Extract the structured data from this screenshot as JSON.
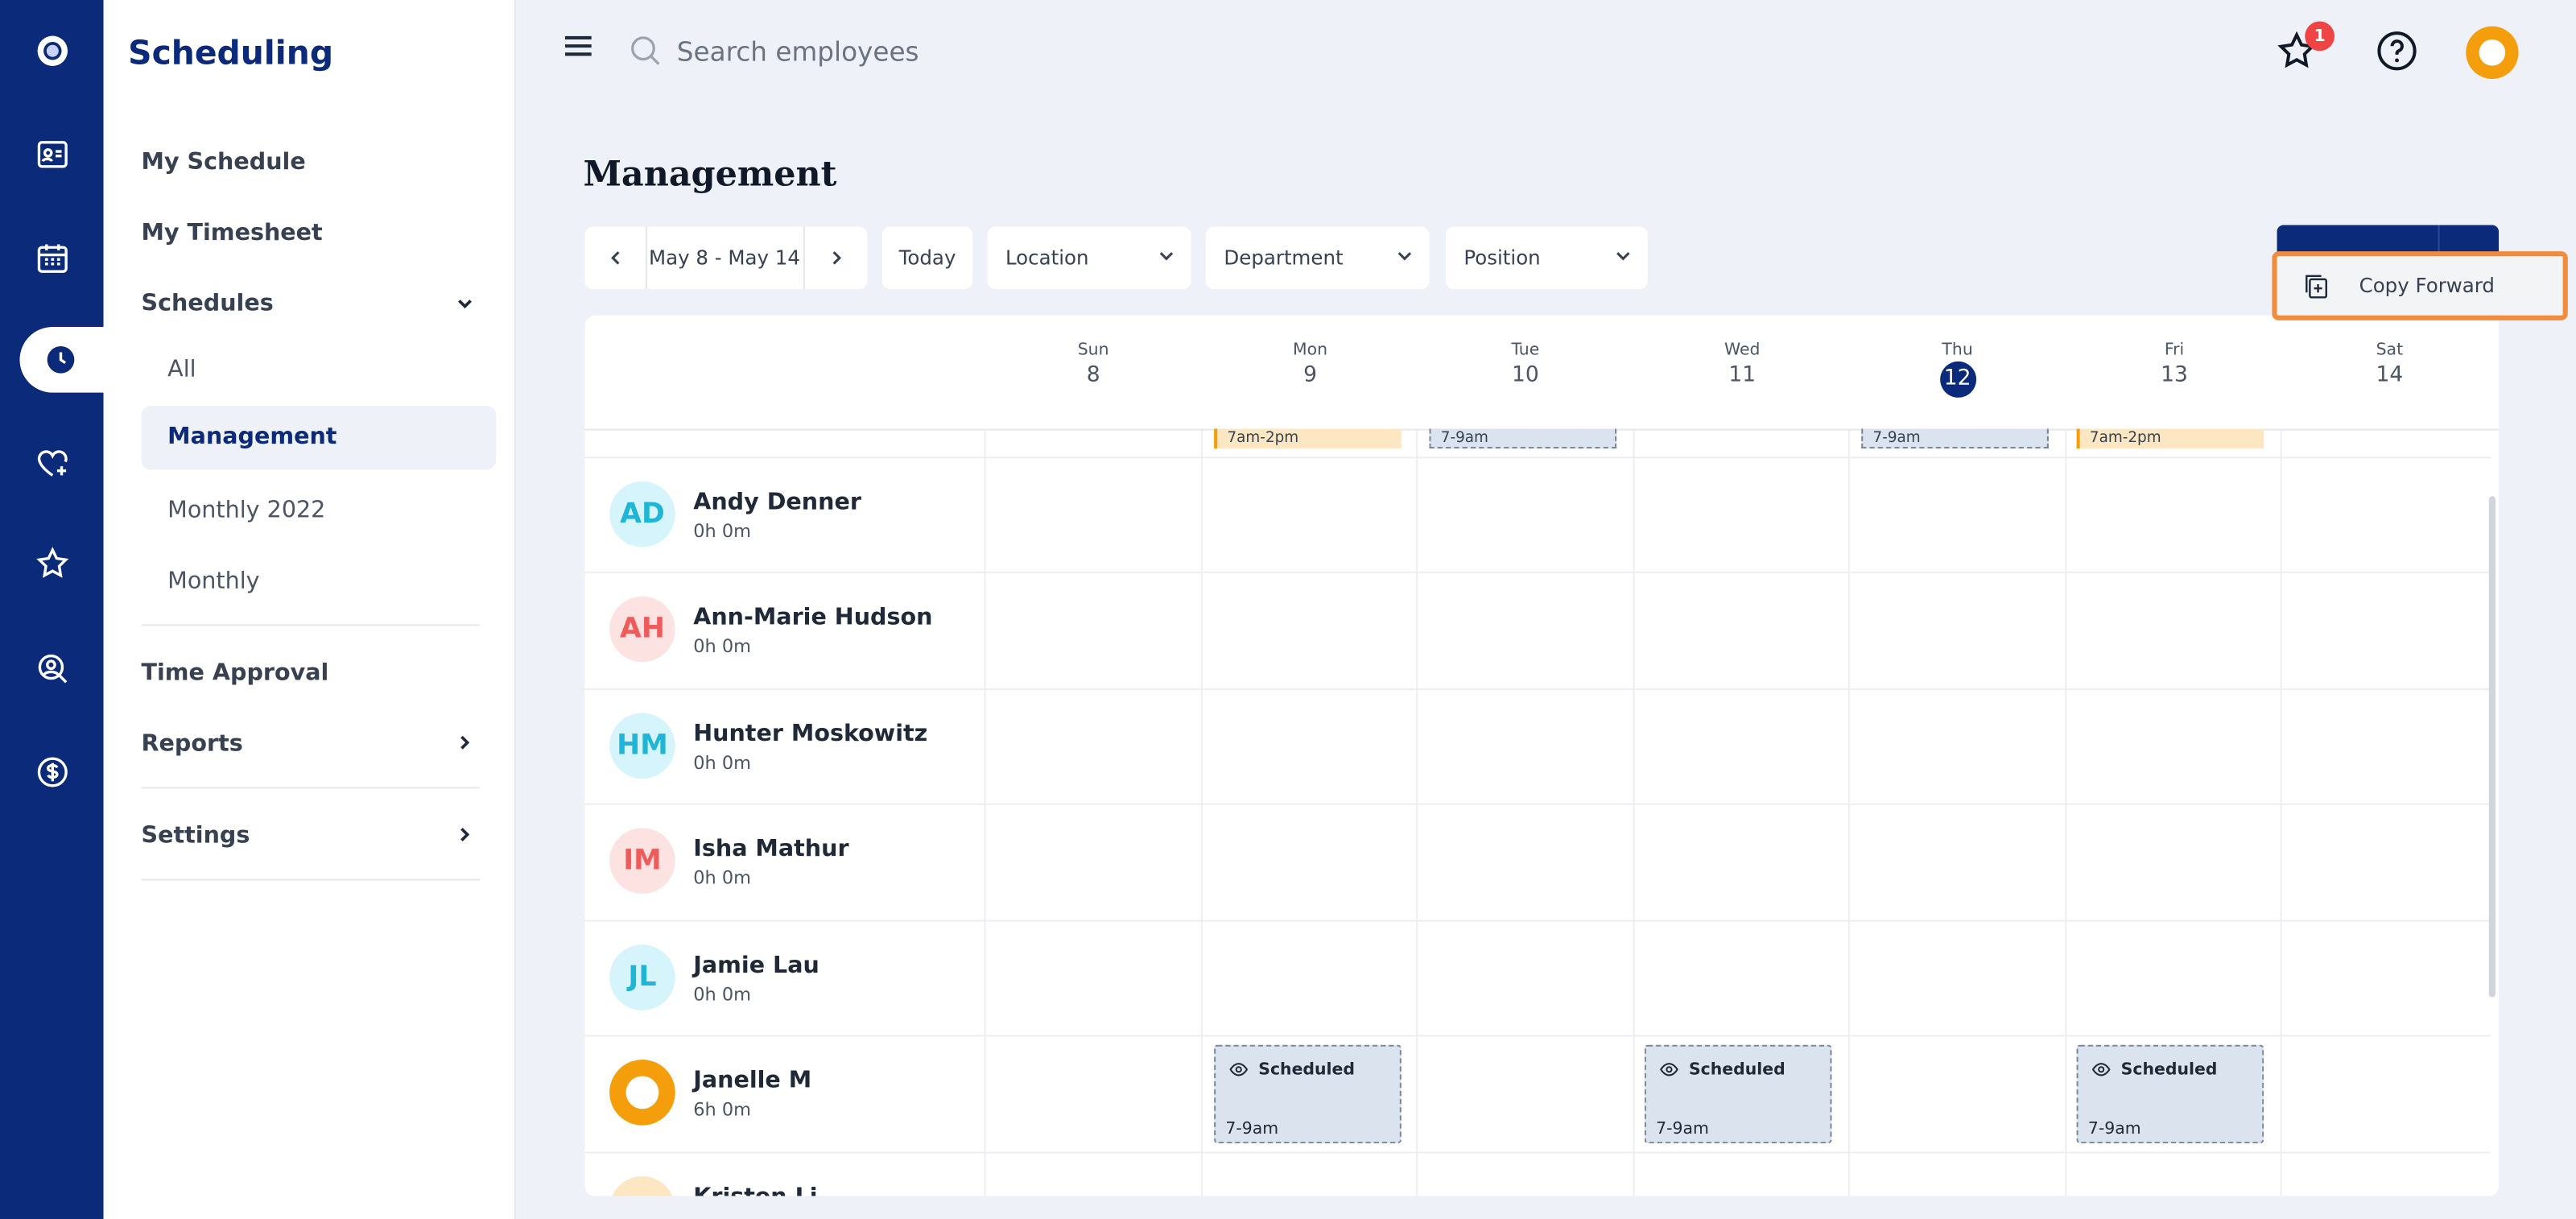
{
  "sidebar": {
    "title": "Scheduling",
    "items": {
      "my_schedule": "My Schedule",
      "my_timesheet": "My Timesheet",
      "schedules": "Schedules",
      "all": "All",
      "management": "Management",
      "monthly_2022": "Monthly 2022",
      "monthly": "Monthly",
      "time_approval": "Time Approval",
      "reports": "Reports",
      "settings": "Settings"
    }
  },
  "topbar": {
    "search_placeholder": "Search employees",
    "notification_count": "1"
  },
  "page": {
    "title": "Management",
    "date_range": "May 8 - May 14",
    "today_label": "Today",
    "filters": {
      "location": "Location",
      "department": "Department",
      "position": "Position"
    }
  },
  "dropdown": {
    "copy_forward": "Copy Forward"
  },
  "days": [
    {
      "name": "Sun",
      "date": "8"
    },
    {
      "name": "Mon",
      "date": "9"
    },
    {
      "name": "Tue",
      "date": "10"
    },
    {
      "name": "Wed",
      "date": "11"
    },
    {
      "name": "Thu",
      "date": "12"
    },
    {
      "name": "Fri",
      "date": "13"
    },
    {
      "name": "Sat",
      "date": "14"
    }
  ],
  "top_shifts": {
    "mon": "7am-2pm",
    "tue": "7-9am",
    "thu": "7-9am",
    "fri": "7am-2pm"
  },
  "employees": [
    {
      "initials": "AD",
      "name": "Andy Denner",
      "hours": "0h 0m"
    },
    {
      "initials": "AH",
      "name": "Ann-Marie Hudson",
      "hours": "0h 0m"
    },
    {
      "initials": "HM",
      "name": "Hunter Moskowitz",
      "hours": "0h 0m"
    },
    {
      "initials": "IM",
      "name": "Isha Mathur",
      "hours": "0h 0m"
    },
    {
      "initials": "JL",
      "name": "Jamie Lau",
      "hours": "0h 0m"
    },
    {
      "initials": "",
      "name": "Janelle M",
      "hours": "6h 0m"
    },
    {
      "initials": "",
      "name": "Kristen Li",
      "hours": ""
    }
  ],
  "shifts": {
    "status": "Scheduled",
    "time": "7-9am"
  },
  "colors": {
    "brand": "#0b2a7a",
    "accent_orange": "#f28c3d",
    "badge": "#ef4444"
  }
}
